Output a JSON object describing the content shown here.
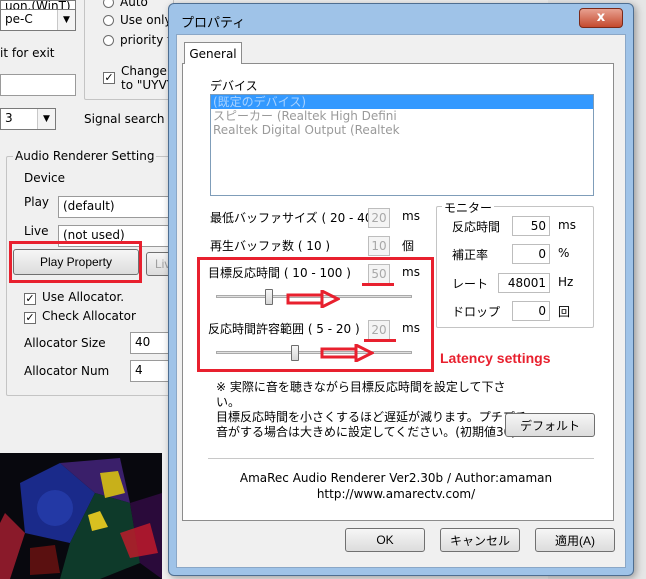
{
  "background": {
    "top_combo_partial": "uon.(WinT)",
    "combo_type": "pe-C",
    "exit_text": "it for exit",
    "radio_auto": "Auto",
    "radio_use_only": "Use only",
    "radio_priority": "priority to",
    "check_change_line1": "Change a",
    "check_change_line2": "to \"UYVY\"",
    "combo_number": "3",
    "signal_label": "Signal search tir",
    "audio_group": "Audio Renderer Setting",
    "device_label": "Device",
    "play_label": "Play",
    "play_value": "(default)",
    "live_label": "Live",
    "live_value": "(not used)",
    "play_property_button": "Play Property",
    "live_partial_button": "Liv",
    "use_allocator": "Use Allocator.",
    "check_allocator": "Check Allocator",
    "allocator_size_label": "Allocator Size",
    "allocator_size_value": "40",
    "allocator_num_label": "Allocator Num",
    "allocator_num_value": "4"
  },
  "dialog": {
    "title": "プロパティ",
    "close_glyph": "x",
    "tab_general": "General",
    "device_label": "デバイス",
    "devices": [
      "(既定のデバイス)",
      "スピーカー (Realtek High Defini",
      "Realtek Digital Output (Realtek"
    ],
    "min_buffer_label": "最低バッファサイズ ( 20 - 40 )",
    "min_buffer_value": "20",
    "min_buffer_unit": "ms",
    "play_buffer_label": "再生バッファ数 ( 10 )",
    "play_buffer_value": "10",
    "play_buffer_unit": "個",
    "target_latency_label": "目標反応時間 ( 10 - 100 )",
    "target_latency_value": "50",
    "target_latency_unit": "ms",
    "tolerance_label": "反応時間許容範囲 ( 5 - 20 )",
    "tolerance_value": "20",
    "tolerance_unit": "ms",
    "target_slider_fraction": 0.26,
    "tolerance_slider_fraction": 0.4,
    "monitor": {
      "title": "モニター",
      "latency_label": "反応時間",
      "latency_value": "50",
      "latency_unit": "ms",
      "correction_label": "補正率",
      "correction_value": "0",
      "correction_unit": "%",
      "rate_label": "レート",
      "rate_value": "48001",
      "rate_unit": "Hz",
      "drop_label": "ドロップ",
      "drop_value": "0",
      "drop_unit": "回"
    },
    "note_line1": "※ 実際に音を聴きながら目標反応時間を設定して下さ",
    "note_line2": "い。",
    "note_line3": "目標反応時間を小さくするほど遅延が減ります。プチプチ",
    "note_line4": "音がする場合は大きめに設定してください。(初期値30)",
    "default_button": "デフォルト",
    "credits_line1": "AmaRec Audio Renderer Ver2.30b / Author:amaman",
    "credits_line2": "http://www.amarectv.com/",
    "ok_button": "OK",
    "cancel_button": "キャンセル",
    "apply_button": "適用(A)"
  },
  "annotation": {
    "latency_settings": "Latency settings",
    "color": "#e8202e"
  }
}
